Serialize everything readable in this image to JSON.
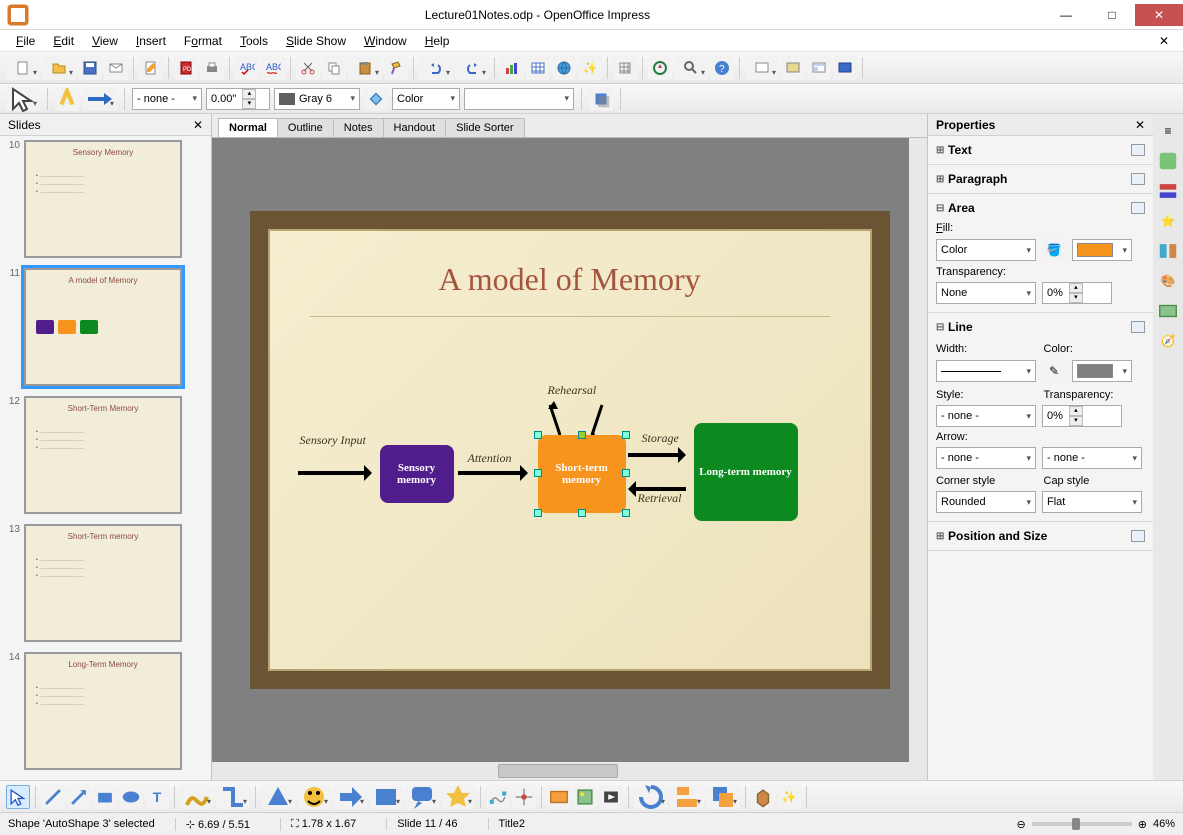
{
  "title": "Lecture01Notes.odp - OpenOffice Impress",
  "menu": [
    "File",
    "Edit",
    "View",
    "Insert",
    "Format",
    "Tools",
    "Slide Show",
    "Window",
    "Help"
  ],
  "toolbar2": {
    "line_style": "- none -",
    "line_width": "0.00\"",
    "line_color": "Gray 6",
    "fill_type": "Color"
  },
  "slides_header": "Slides",
  "slides": [
    {
      "num": "10",
      "title": "Sensory Memory",
      "sel": false,
      "kind": "text"
    },
    {
      "num": "11",
      "title": "A model of Memory",
      "sel": true,
      "kind": "diagram"
    },
    {
      "num": "12",
      "title": "Short-Term Memory",
      "sel": false,
      "kind": "text"
    },
    {
      "num": "13",
      "title": "Short-Term memory",
      "sel": false,
      "kind": "text"
    },
    {
      "num": "14",
      "title": "Long-Term Memory",
      "sel": false,
      "kind": "text"
    }
  ],
  "view_tabs": [
    "Normal",
    "Outline",
    "Notes",
    "Handout",
    "Slide Sorter"
  ],
  "slide": {
    "title": "A model of Memory",
    "labels": {
      "sensory_input": "Sensory Input",
      "attention": "Attention",
      "rehearsal": "Rehearsal",
      "storage": "Storage",
      "retrieval": "Retrieval"
    },
    "boxes": {
      "sensory": "Sensory memory",
      "stm": "Short-term memory",
      "ltm": "Long-term memory"
    }
  },
  "props": {
    "header": "Properties",
    "sections": {
      "text": "Text",
      "paragraph": "Paragraph",
      "area": "Area",
      "line": "Line",
      "pos": "Position and Size"
    },
    "area": {
      "fill_label": "Fill:",
      "fill_type": "Color",
      "fill_color": "#f7941e",
      "transp_label": "Transparency:",
      "transp_type": "None",
      "transp_val": "0%"
    },
    "line": {
      "width": "Width:",
      "color": "Color:",
      "color_val": "#808080",
      "style": "Style:",
      "style_val": "- none -",
      "transp": "Transparency:",
      "transp_val": "0%",
      "arrow": "Arrow:",
      "arrow_l": "- none -",
      "arrow_r": "- none -",
      "corner": "Corner style",
      "corner_val": "Rounded",
      "cap": "Cap style",
      "cap_val": "Flat"
    }
  },
  "status": {
    "shape": "Shape 'AutoShape 3' selected",
    "pos": "6.69 / 5.51",
    "size": "1.78 x 1.67",
    "slide": "Slide 11 / 46",
    "theme": "Title2",
    "zoom": "46%"
  }
}
